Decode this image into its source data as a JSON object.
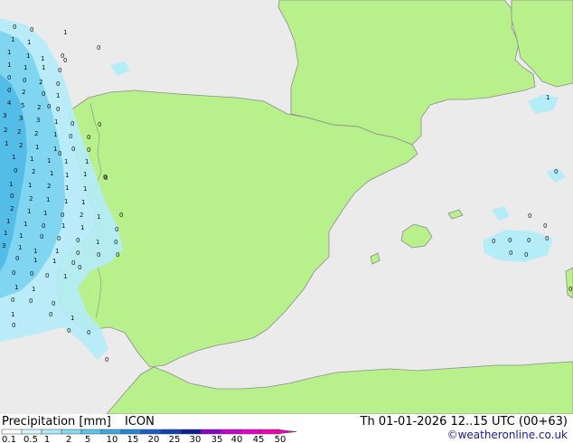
{
  "map": {
    "sea_color": "#ebebeb",
    "land_color": "#b8f08c",
    "coast_color": "#8c8c8c",
    "precip_light": "#b4ecf8",
    "precip_mid": "#7cd4f0",
    "precip_heavy": "#50bce6",
    "numbers": [
      {
        "t": "0"
      },
      {
        "t": "0"
      },
      {
        "t": "1"
      },
      {
        "t": "0"
      },
      {
        "t": "1"
      },
      {
        "t": "1"
      },
      {
        "t": "1"
      },
      {
        "t": "1"
      },
      {
        "t": "0"
      },
      {
        "t": "1"
      },
      {
        "t": "1"
      },
      {
        "t": "1"
      },
      {
        "t": "1"
      },
      {
        "t": "0"
      },
      {
        "t": "0"
      },
      {
        "t": "0"
      },
      {
        "t": "2"
      },
      {
        "t": "0"
      },
      {
        "t": "0"
      },
      {
        "t": "2"
      },
      {
        "t": "0"
      },
      {
        "t": "4"
      },
      {
        "t": "5"
      },
      {
        "t": "2"
      },
      {
        "t": "0"
      },
      {
        "t": "3"
      },
      {
        "t": "3"
      },
      {
        "t": "3"
      },
      {
        "t": "1"
      },
      {
        "t": "0"
      },
      {
        "t": "2"
      },
      {
        "t": "2"
      },
      {
        "t": "2"
      },
      {
        "t": "1"
      },
      {
        "t": "0"
      },
      {
        "t": "1"
      },
      {
        "t": "2"
      },
      {
        "t": "1"
      },
      {
        "t": "1"
      },
      {
        "t": "0"
      },
      {
        "t": "1"
      },
      {
        "t": "1"
      },
      {
        "t": "1"
      },
      {
        "t": "1"
      },
      {
        "t": "1"
      },
      {
        "t": "0"
      },
      {
        "t": "2"
      },
      {
        "t": "1"
      },
      {
        "t": "1"
      },
      {
        "t": "1"
      },
      {
        "t": "0"
      },
      {
        "t": "1"
      },
      {
        "t": "1"
      },
      {
        "t": "2"
      },
      {
        "t": "1"
      },
      {
        "t": "1"
      },
      {
        "t": "0"
      },
      {
        "t": "2"
      },
      {
        "t": "1"
      },
      {
        "t": "1"
      },
      {
        "t": "1"
      },
      {
        "t": "2"
      },
      {
        "t": "1"
      },
      {
        "t": "1"
      },
      {
        "t": "0"
      },
      {
        "t": "2"
      },
      {
        "t": "1"
      },
      {
        "t": "1"
      },
      {
        "t": "1"
      },
      {
        "t": "0"
      },
      {
        "t": "1"
      },
      {
        "t": "1"
      },
      {
        "t": "1"
      },
      {
        "t": "1"
      },
      {
        "t": "0"
      },
      {
        "t": "0"
      },
      {
        "t": "0"
      },
      {
        "t": "3"
      },
      {
        "t": "1"
      },
      {
        "t": "1"
      },
      {
        "t": "1"
      },
      {
        "t": "0"
      },
      {
        "t": "0"
      },
      {
        "t": "1"
      },
      {
        "t": "1"
      },
      {
        "t": "0"
      },
      {
        "t": "0"
      },
      {
        "t": "0"
      },
      {
        "t": "0"
      },
      {
        "t": "1"
      },
      {
        "t": "1"
      },
      {
        "t": "1"
      },
      {
        "t": "0"
      },
      {
        "t": "0"
      },
      {
        "t": "0"
      },
      {
        "t": "1"
      },
      {
        "t": "1"
      },
      {
        "t": "0"
      },
      {
        "t": "0"
      },
      {
        "t": "0"
      },
      {
        "t": "0"
      },
      {
        "t": "0"
      },
      {
        "t": "0"
      },
      {
        "t": "1"
      },
      {
        "t": "0"
      },
      {
        "t": "0"
      },
      {
        "t": "0"
      },
      {
        "t": "0"
      },
      {
        "t": "0"
      },
      {
        "t": "0"
      },
      {
        "t": "0"
      },
      {
        "t": "0"
      },
      {
        "t": "0"
      },
      {
        "t": "0"
      },
      {
        "t": "0"
      },
      {
        "t": "0"
      },
      {
        "t": "0"
      },
      {
        "t": "0"
      },
      {
        "t": "0"
      },
      {
        "t": "0"
      },
      {
        "t": "1"
      },
      {
        "t": "0"
      },
      {
        "t": "0"
      },
      {
        "t": "0"
      },
      {
        "t": "1"
      },
      {
        "t": "0"
      },
      {
        "t": "0"
      },
      {
        "t": "0"
      }
    ]
  },
  "footer": {
    "title": "Precipitation [mm]",
    "model": "ICON",
    "valid_time": "Th 01-01-2026 12..15 UTC (00+63)",
    "credit": "©weatheronline.co.uk"
  },
  "legend": {
    "labels": [
      "0.1",
      "0.5",
      "1",
      "2",
      "5",
      "10",
      "15",
      "20",
      "25",
      "30",
      "35",
      "40",
      "45",
      "50"
    ],
    "colors": [
      "#ffffff",
      "#d2f5fc",
      "#aaeaf8",
      "#82daf2",
      "#5ac4ec",
      "#3ca8e4",
      "#2484d8",
      "#1860c8",
      "#1040b4",
      "#0a1e96",
      "#8c00c8",
      "#c800d2",
      "#e600c8",
      "#f500b4"
    ]
  }
}
